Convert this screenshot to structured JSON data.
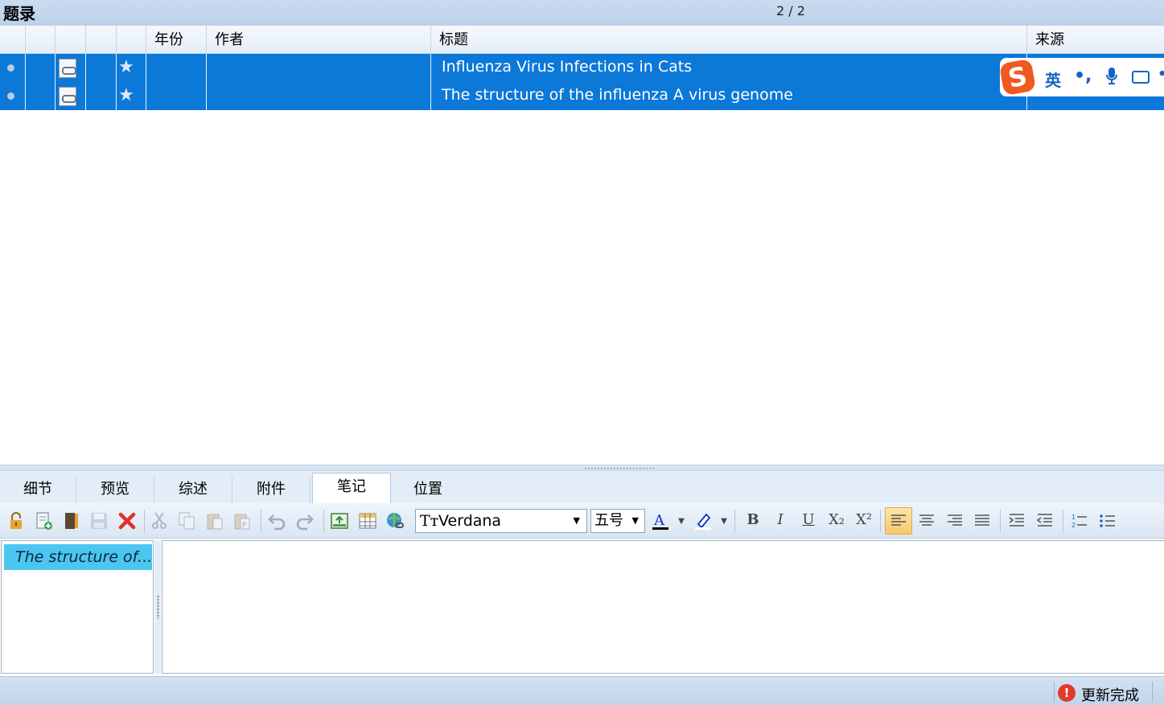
{
  "window": {
    "title": "题录",
    "record_count": "2 / 2"
  },
  "grid": {
    "columns": [
      "",
      "",
      "",
      "",
      "",
      "年份",
      "作者",
      "标题",
      "来源"
    ],
    "rows": [
      {
        "year": "",
        "author": "",
        "title": "Influenza Virus Infections in Cats",
        "source": ""
      },
      {
        "year": "",
        "author": "",
        "title": "The structure of the influenza A virus genome",
        "source": ""
      }
    ]
  },
  "ime": {
    "logo": "S",
    "mode": "英",
    "punct": "•,",
    "more": "•"
  },
  "tabs": [
    "细节",
    "预览",
    "综述",
    "附件",
    "笔记",
    "位置"
  ],
  "active_tab": "笔记",
  "toolbar": {
    "font_family": "Verdana",
    "font_size": "五号",
    "bold": "B",
    "italic": "I",
    "underline": "U",
    "subscript": "X₂",
    "superscript": "X²",
    "text_color": "#1030c0",
    "highlight_color": "#1030c0"
  },
  "notes": {
    "items": [
      "The structure of..."
    ]
  },
  "status": {
    "text": "更新完成",
    "icon": "error-icon"
  },
  "colors": {
    "selection": "#0c78d8",
    "note_highlight": "#4bc6f0",
    "ime_logo": "#f05a20"
  }
}
